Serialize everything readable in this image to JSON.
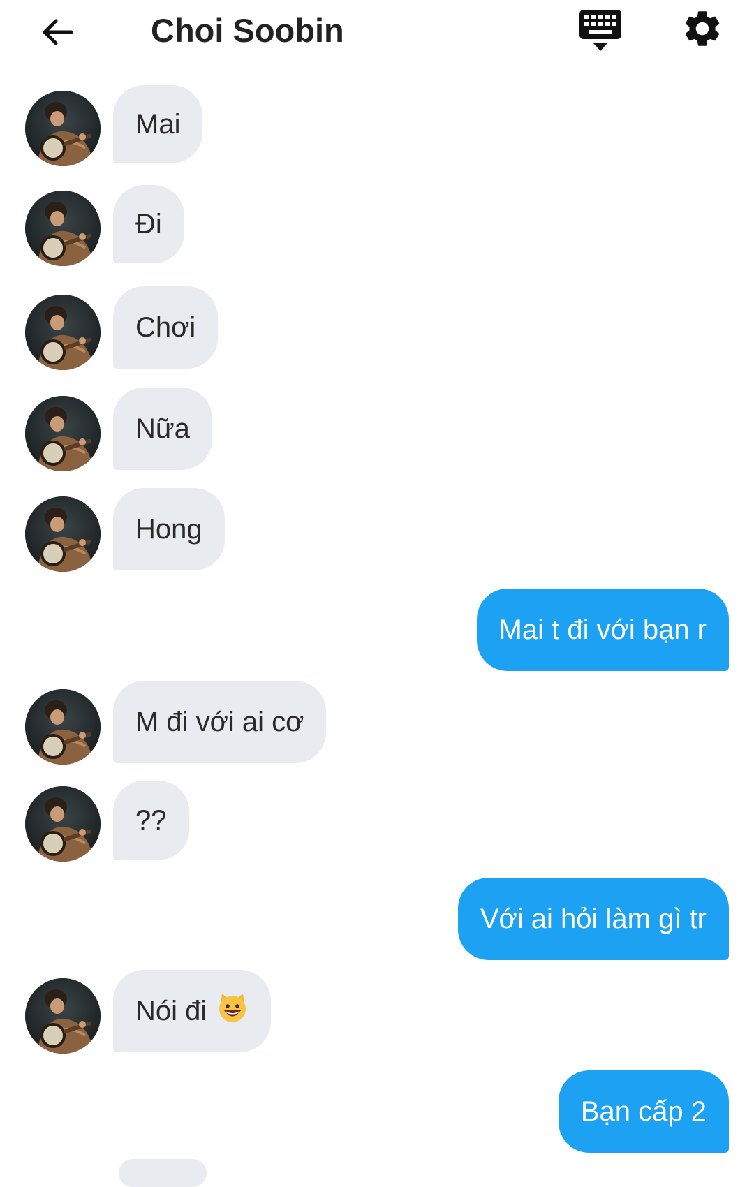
{
  "header": {
    "title": "Choi Soobin",
    "back_icon": "arrow-left-icon",
    "keyboard_icon": "keyboard-icon",
    "settings_icon": "gear-icon"
  },
  "colors": {
    "incoming_bubble": "#e8ebef",
    "outgoing_bubble": "#1da1f2",
    "outgoing_text": "#ffffff"
  },
  "messages": [
    {
      "from": "them",
      "text": "Mai"
    },
    {
      "from": "them",
      "text": "Đi"
    },
    {
      "from": "them",
      "text": "Chơi"
    },
    {
      "from": "them",
      "text": "Nữa"
    },
    {
      "from": "them",
      "text": "Hong"
    },
    {
      "from": "me",
      "text": "Mai t đi với bạn r"
    },
    {
      "from": "them",
      "text": "M đi với ai cơ"
    },
    {
      "from": "them",
      "text": "??"
    },
    {
      "from": "me",
      "text": "Với ai hỏi làm gì tr"
    },
    {
      "from": "them",
      "text": "Nói đi",
      "emoji": "cat-grin-emoji"
    },
    {
      "from": "me",
      "text": "Bạn cấp 2"
    }
  ]
}
